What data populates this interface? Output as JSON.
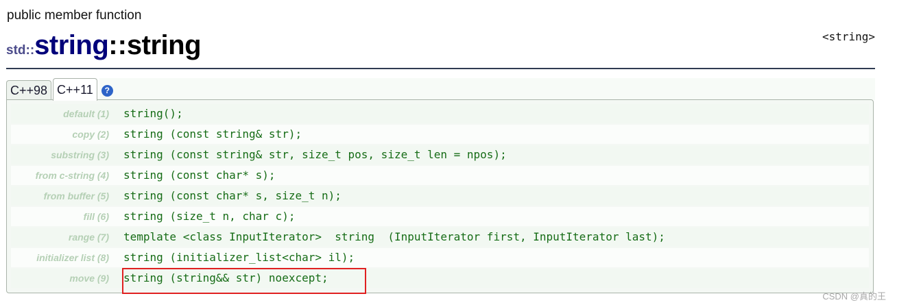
{
  "page": {
    "kind": "public member function",
    "namespace": "std::",
    "type_name": "string",
    "separator": "::",
    "member_name": "string",
    "header": "<string>"
  },
  "tabs": [
    {
      "label": "C++98",
      "active": false
    },
    {
      "label": "C++11",
      "active": true
    }
  ],
  "help_icon": {
    "name": "help-icon",
    "glyph": "?"
  },
  "constructors": [
    {
      "label": "default (1)",
      "signature": "string();"
    },
    {
      "label": "copy (2)",
      "signature": "string (const string& str);"
    },
    {
      "label": "substring (3)",
      "signature": "string (const string& str, size_t pos, size_t len = npos);"
    },
    {
      "label": "from c-string (4)",
      "signature": "string (const char* s);"
    },
    {
      "label": "from buffer (5)",
      "signature": "string (const char* s, size_t n);"
    },
    {
      "label": "fill (6)",
      "signature": "string (size_t n, char c);"
    },
    {
      "label": "range (7)",
      "signature": "template <class InputIterator>  string  (InputIterator first, InputIterator last);"
    },
    {
      "label": "initializer list (8)",
      "signature": "string (initializer_list<char> il);"
    },
    {
      "label": "move (9)",
      "signature": "string (string&& str) noexcept;"
    }
  ],
  "watermark": "CSDN @真的王",
  "colors": {
    "accent": "#00007a",
    "signature": "#166c16",
    "label": "#b5d0b5",
    "highlight": "#e02020"
  }
}
